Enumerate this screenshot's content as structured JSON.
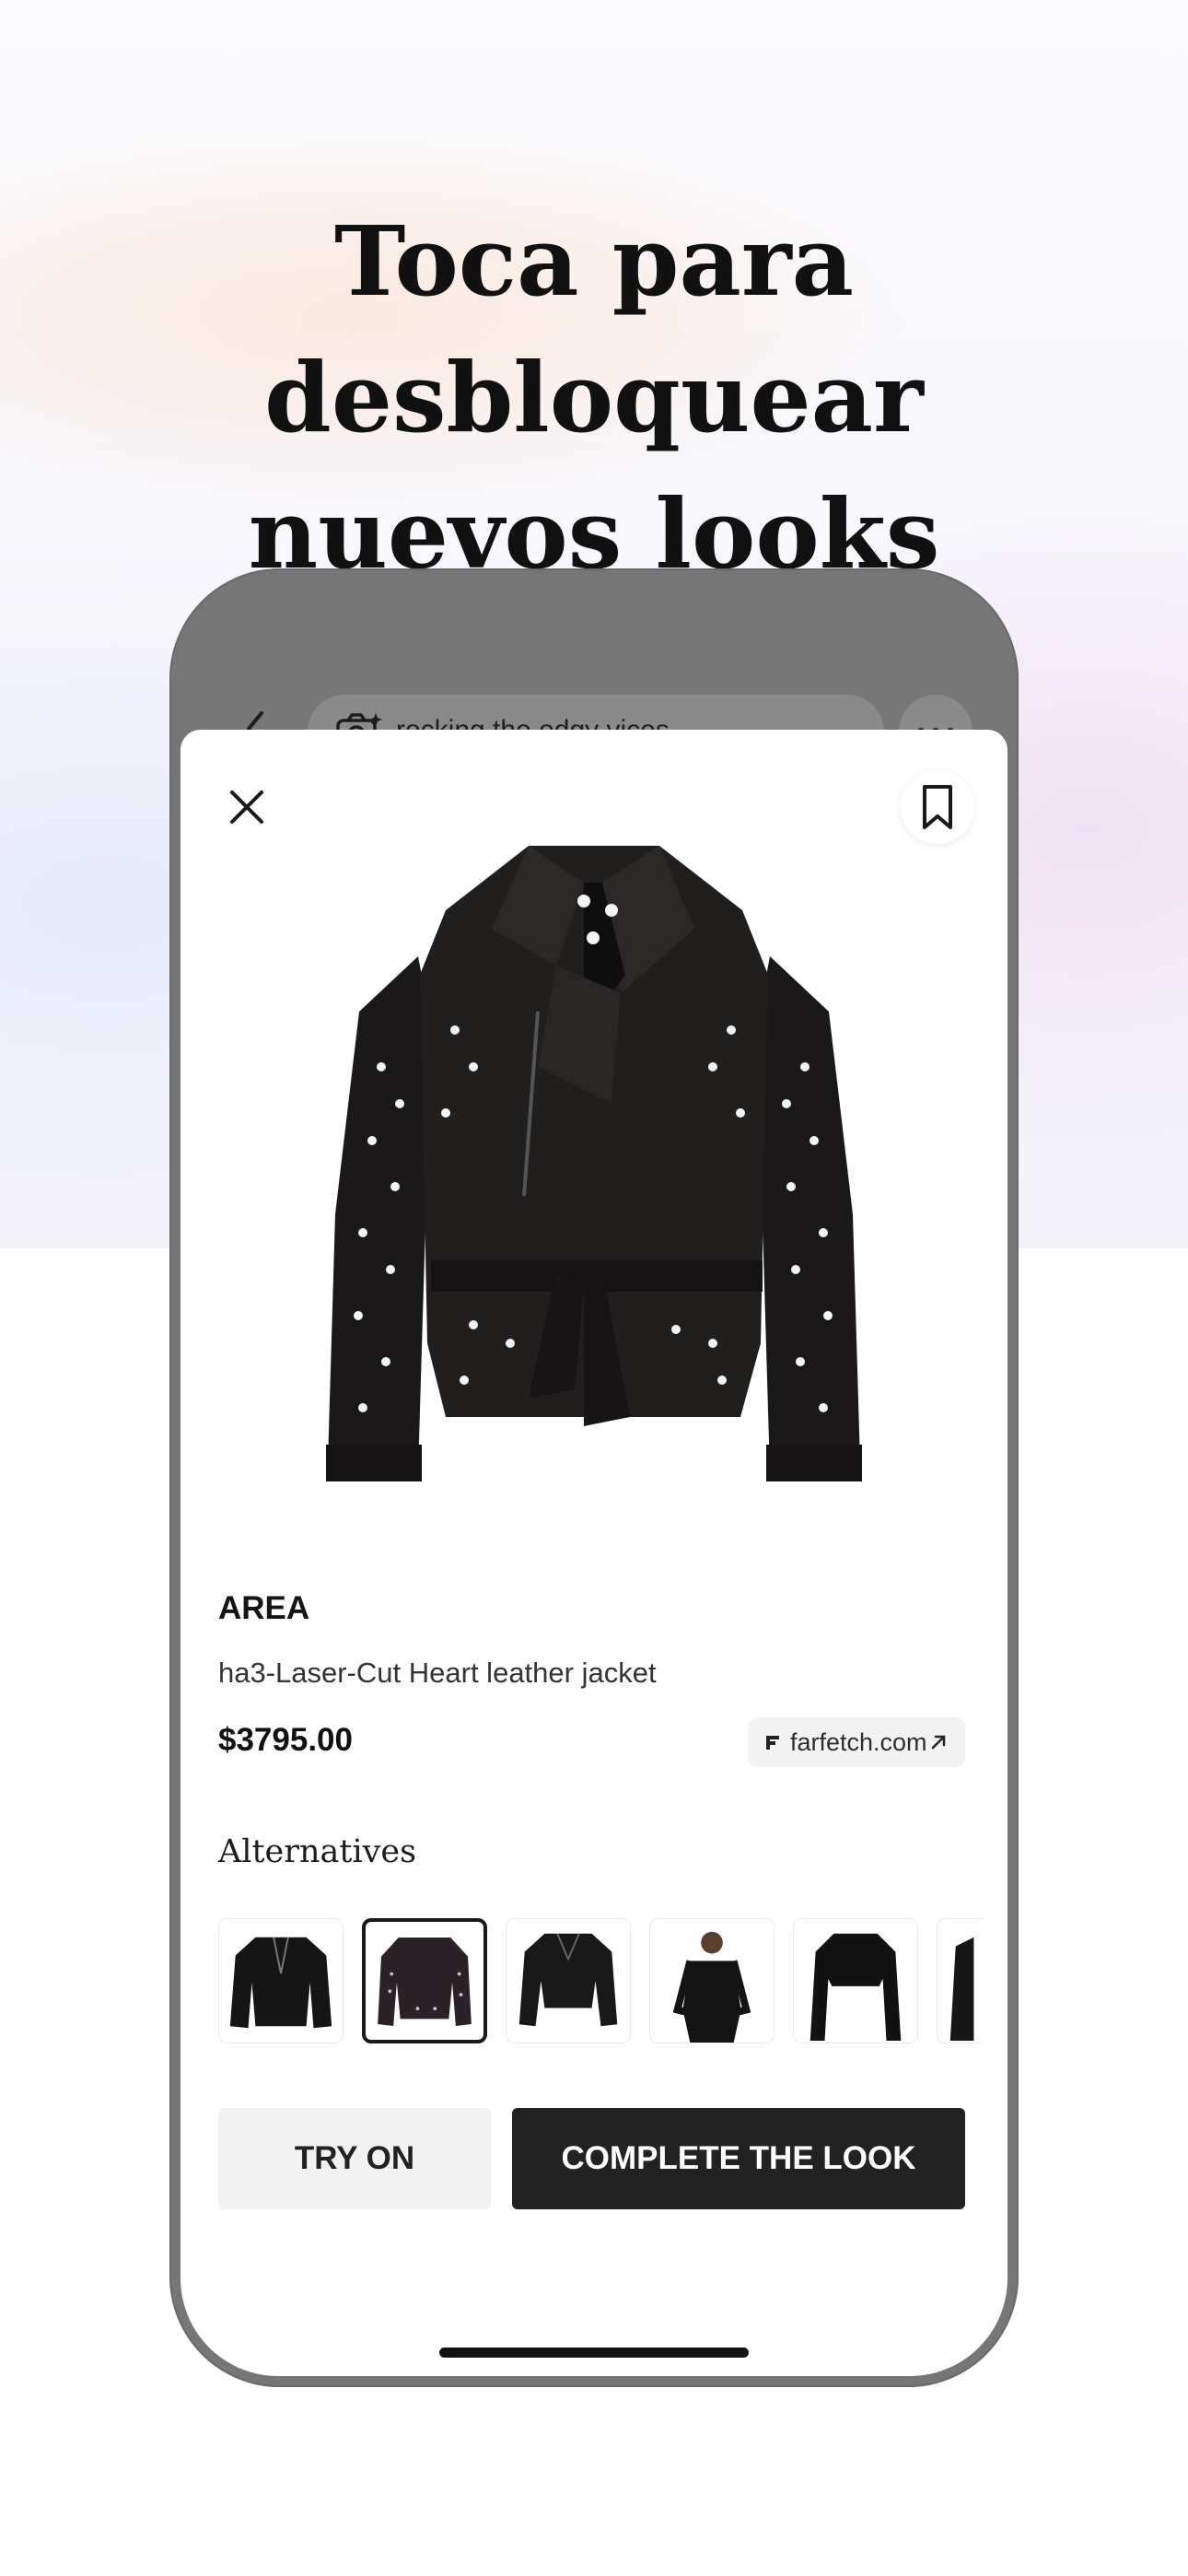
{
  "headline": {
    "line1": "Toca para desbloquear",
    "line2": "nuevos looks"
  },
  "search": {
    "query": "rocking the edgy vices"
  },
  "product": {
    "brand": "AREA",
    "title": "ha3-Laser-Cut Heart leather jacket",
    "price": "$3795.00",
    "source": "farfetch.com"
  },
  "alternatives": {
    "heading": "Alternatives",
    "selected_index": 1
  },
  "actions": {
    "try_on": "TRY ON",
    "complete_look": "COMPLETE THE LOOK"
  },
  "icons": {
    "back": "chevron-left-icon",
    "camera": "camera-sparkle-icon",
    "more": "more-horizontal-icon",
    "close": "close-icon",
    "bookmark": "bookmark-icon",
    "source": "farfetch-logo-icon",
    "external": "external-link-icon"
  }
}
